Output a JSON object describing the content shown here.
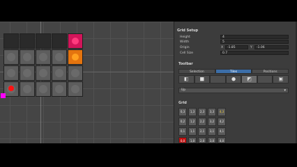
{
  "scene": {
    "toolbar_icons": [
      "move-icon",
      "rotate-icon",
      "scale-icon",
      "gizmo-icon",
      "eye-icon",
      "layers-icon",
      "settings-icon"
    ]
  },
  "inspector": {
    "grid_setup_title": "Grid Setup",
    "height_label": "Height",
    "height_value": "4",
    "width_label": "Width",
    "width_value": "5",
    "origin_label": "Origin",
    "origin_x_label": "X",
    "origin_x_value": "-1.85",
    "origin_y_label": "Y",
    "origin_y_value": "-1.06",
    "cell_size_label": "Cell Size",
    "cell_size_value": "0.7",
    "toolbar_title": "Toolbar",
    "tabs": [
      "Selection",
      "Tiles",
      "Positions"
    ],
    "active_tab": "Tiles",
    "tools": [
      "◧",
      "■",
      "",
      "●",
      "◩",
      "",
      "▣"
    ],
    "selected_tool_index": 4,
    "dropdown_value": "Up",
    "grid_title": "Grid",
    "grid_rows": [
      [
        "0,3",
        "1,3",
        "2,3",
        "3,3",
        "4,3"
      ],
      [
        "0,2",
        "1,2",
        "2,2",
        "3,2",
        "4,2"
      ],
      [
        "0,1",
        "1,1",
        "2,1",
        "3,1",
        "4,1"
      ],
      [
        "0,0",
        "1,0",
        "2,0",
        "3,0",
        "4,0"
      ]
    ]
  }
}
